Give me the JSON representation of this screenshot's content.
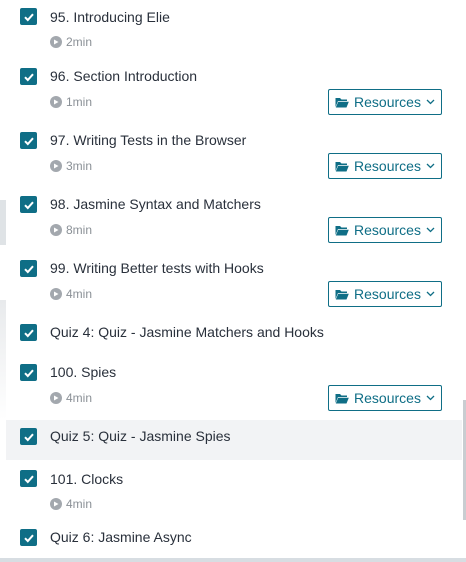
{
  "lectures": [
    {
      "title": "95. Introducing Elie",
      "duration": "2min",
      "resources": false
    },
    {
      "title": "96. Section Introduction",
      "duration": "1min",
      "resources": true
    },
    {
      "title": "97. Writing Tests in the Browser",
      "duration": "3min",
      "resources": true
    },
    {
      "title": "98. Jasmine Syntax and Matchers",
      "duration": "8min",
      "resources": true
    },
    {
      "title": "99. Writing Better tests with Hooks",
      "duration": "4min",
      "resources": true
    },
    {
      "title": "Quiz 4: Quiz - Jasmine Matchers and Hooks",
      "duration": null,
      "resources": false
    },
    {
      "title": "100. Spies",
      "duration": "4min",
      "resources": true
    },
    {
      "title": "Quiz 5: Quiz - Jasmine Spies",
      "duration": null,
      "resources": false,
      "highlighted": true
    },
    {
      "title": "101. Clocks",
      "duration": "4min",
      "resources": false
    },
    {
      "title": "Quiz 6: Jasmine Async",
      "duration": null,
      "resources": false
    }
  ],
  "resources_label": "Resources",
  "colors": {
    "accent": "#0f6e86",
    "text": "#29303b",
    "muted": "#8a9096",
    "highlight": "#f2f3f5"
  }
}
